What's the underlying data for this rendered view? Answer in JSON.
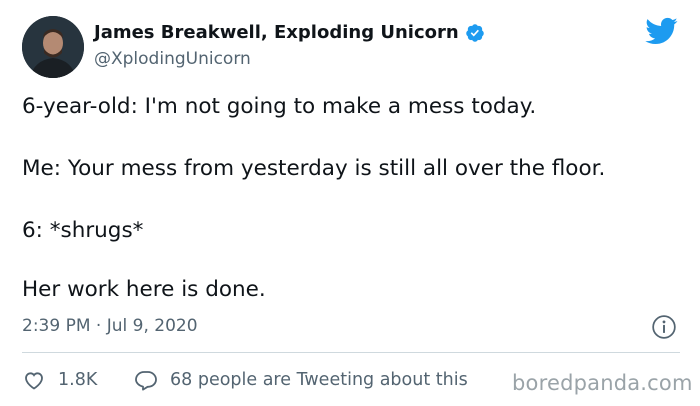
{
  "tweet": {
    "author": {
      "display_name": "James Breakwell, Exploding Unicorn",
      "handle": "@XplodingUnicorn",
      "verified": true
    },
    "lines": [
      "6-year-old: I'm not going to make a mess today.",
      "Me: Your mess from yesterday is still all over the floor.",
      "6: *shrugs*",
      "Her work here is done."
    ],
    "timestamp": "2:39 PM · Jul 9, 2020",
    "likes": "1.8K",
    "reply_text": "68 people are Tweeting about this"
  },
  "watermark": "boredpanda.com",
  "colors": {
    "brand": "#1d9bf0",
    "secondary_text": "#536471",
    "divider": "#cfd9de"
  },
  "icons": [
    "avatar-photo",
    "verified-badge-icon",
    "twitter-bird-icon",
    "info-icon",
    "heart-icon",
    "reply-bubble-icon"
  ]
}
